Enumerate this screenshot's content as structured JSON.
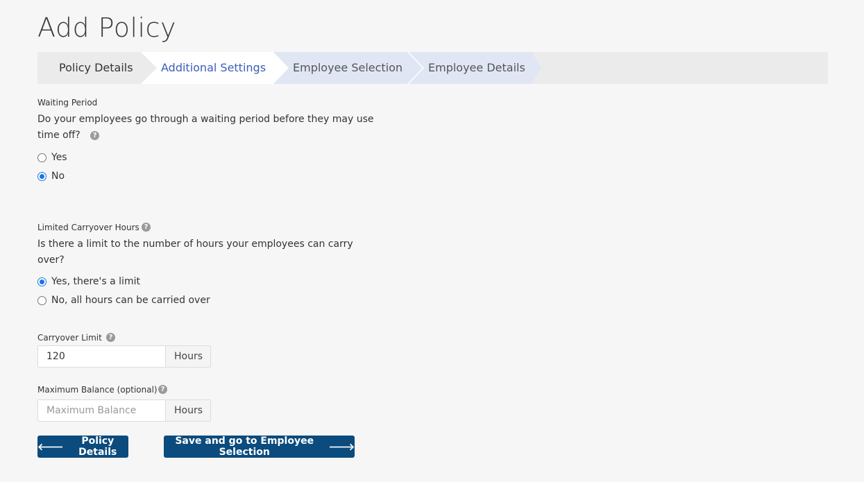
{
  "page": {
    "title": "Add Policy"
  },
  "wizard": {
    "steps": [
      {
        "label": "Policy Details",
        "state": "completed"
      },
      {
        "label": "Additional Settings",
        "state": "active"
      },
      {
        "label": "Employee Selection",
        "state": "upcoming"
      },
      {
        "label": "Employee Details",
        "state": "upcoming"
      }
    ]
  },
  "waiting_period": {
    "label": "Waiting Period",
    "question_line1": "Do your employees go through a waiting period before they may use",
    "question_line2": "time off?",
    "options": [
      {
        "label": "Yes",
        "checked": false
      },
      {
        "label": "No",
        "checked": true
      }
    ]
  },
  "carryover": {
    "label": "Limited Carryover Hours",
    "question_line1": "Is there a limit to the number of hours your employees can carry",
    "question_line2": "over?",
    "options": [
      {
        "label": "Yes, there's a limit",
        "checked": true
      },
      {
        "label": "No, all hours can be carried over",
        "checked": false
      }
    ]
  },
  "carryover_limit": {
    "label": "Carryover Limit",
    "value": "120",
    "unit": "Hours"
  },
  "max_balance": {
    "label": "Maximum Balance (optional)",
    "placeholder": "Maximum Balance",
    "value": "",
    "unit": "Hours"
  },
  "buttons": {
    "back_label": "Policy Details",
    "next_label": "Save and go to Employee Selection"
  },
  "icons": {
    "help": "question-circle-icon",
    "back": "arrow-left-icon",
    "next": "arrow-right-icon"
  },
  "colors": {
    "primary_button": "#0b4b7d",
    "active_step_text": "#3a5db8",
    "active_step_bg": "#ffffff",
    "upcoming_step_bg": "#e1e6f5",
    "completed_step_bg": "#ebebeb",
    "radio_checked": "#1a73e8"
  }
}
